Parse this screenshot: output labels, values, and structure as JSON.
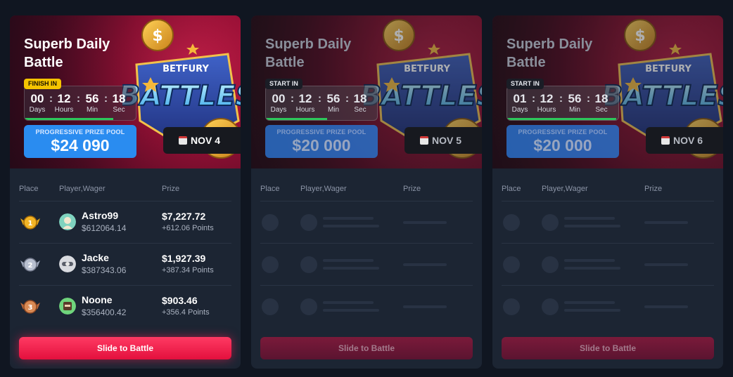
{
  "cards": [
    {
      "title": "Superb Daily Battle",
      "timer_label": "FINISH IN",
      "timer": {
        "days": "00",
        "hours": "12",
        "min": "56",
        "sec": "18"
      },
      "timer_progress": 0.8,
      "pool_label": "PROGRESSIVE PRIZE POOL",
      "pool_value": "$24 090",
      "date": "NOV 4",
      "button": "Slide to Battle",
      "rows": [
        {
          "name": "Astro99",
          "wager": "$612064.14",
          "prize": "$7,227.72",
          "points": "+612.06 Points",
          "place": "1"
        },
        {
          "name": "Jacke",
          "wager": "$387343.06",
          "prize": "$1,927.39",
          "points": "+387.34 Points",
          "place": "2"
        },
        {
          "name": "Noone",
          "wager": "$356400.42",
          "prize": "$903.46",
          "points": "+356.4 Points",
          "place": "3"
        }
      ]
    },
    {
      "title": "Superb Daily Battle",
      "timer_label": "START IN",
      "timer": {
        "days": "00",
        "hours": "12",
        "min": "56",
        "sec": "18"
      },
      "timer_progress": 0.55,
      "pool_label": "PROGRESSIVE PRIZE POOL",
      "pool_value": "$20 000",
      "date": "NOV 5",
      "button": "Slide to Battle"
    },
    {
      "title": "Superb Daily Battle",
      "timer_label": "START IN",
      "timer": {
        "days": "01",
        "hours": "12",
        "min": "56",
        "sec": "18"
      },
      "timer_progress": 0.98,
      "pool_label": "PROGRESSIVE PRIZE POOL",
      "pool_value": "$20 000",
      "date": "NOV 6",
      "button": "Slide to Battle"
    }
  ],
  "table_headers": {
    "place": "Place",
    "player": "Player,Wager",
    "prize": "Prize"
  },
  "timer_units": {
    "days": "Days",
    "hours": "Hours",
    "min": "Min",
    "sec": "Sec"
  },
  "logo": {
    "brand": "BETFURY",
    "word": "BATTLES"
  },
  "colors": {
    "accent_red": "#e3103d",
    "pool_blue": "#2a8cf0",
    "progress_green": "#2dc65a",
    "gold": "#e2a321"
  }
}
